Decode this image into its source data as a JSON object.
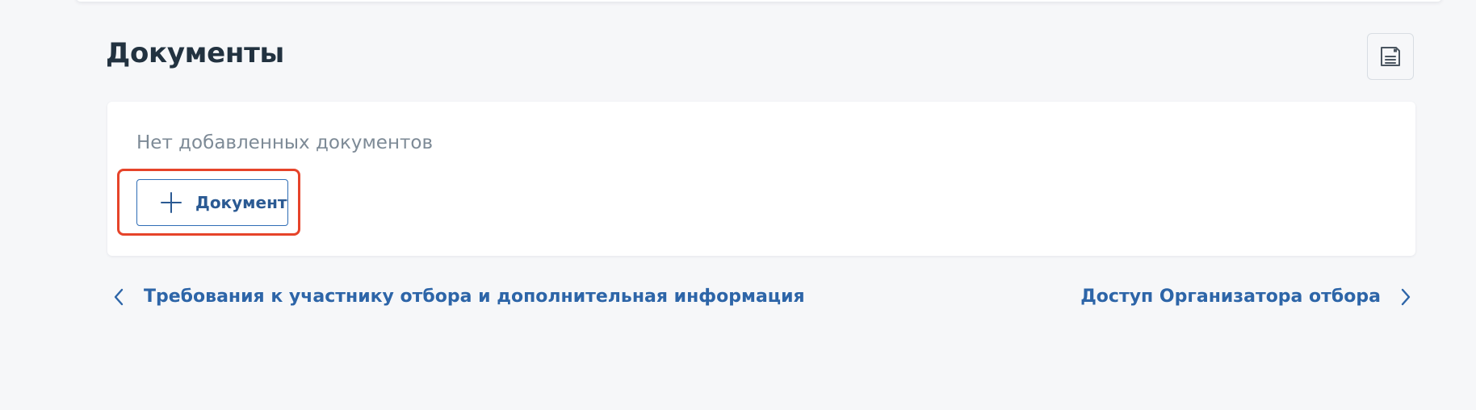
{
  "page": {
    "title": "Документы"
  },
  "toolbar": {
    "save_icon": "save-draft-icon"
  },
  "documents": {
    "empty_text": "Нет добавленных документов",
    "add_button_label": "Документ",
    "add_button_icon": "plus-icon"
  },
  "navigation": {
    "prev_label": "Требования к участнику отбора и дополнительная информация",
    "next_label": "Доступ Организатора отбора",
    "prev_icon": "chevron-left-icon",
    "next_icon": "chevron-right-icon"
  },
  "colors": {
    "accent": "#2d65a8",
    "highlight": "#e6442a",
    "title": "#223240",
    "muted_text": "#7d8a96",
    "background": "#f6f7f9"
  }
}
